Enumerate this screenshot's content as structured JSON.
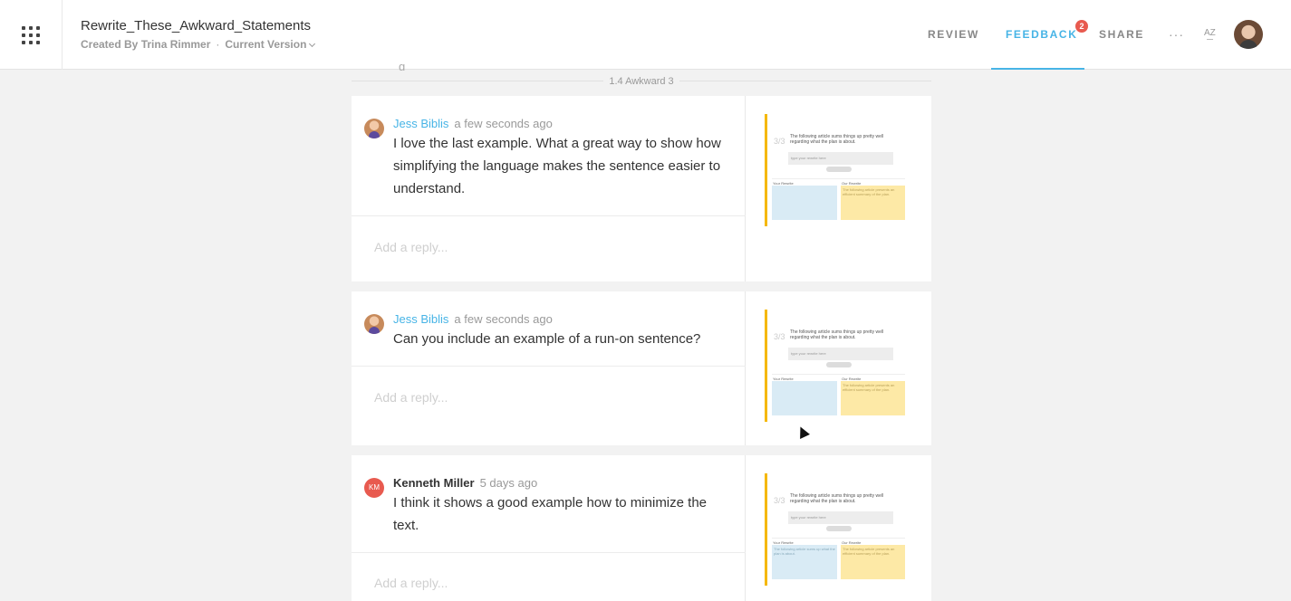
{
  "header": {
    "title": "Rewrite_These_Awkward_Statements",
    "created_by": "Created By Trina Rimmer",
    "separator": "·",
    "version": "Current Version",
    "nav": {
      "review": "REVIEW",
      "feedback": "FEEDBACK",
      "share": "SHARE"
    },
    "feedback_badge": "2",
    "more": "···",
    "sort": "AZ"
  },
  "section": {
    "label": "1.4 Awkward 3",
    "partial_text": "g"
  },
  "comments": [
    {
      "author": "Jess Biblis",
      "time": "a few seconds ago",
      "text": "I love the last example. What a great way to show how simplifying the language makes the sentence easier to understand.",
      "reply_placeholder": "Add a reply..."
    },
    {
      "author": "Jess Biblis",
      "time": "a few seconds ago",
      "text": "Can you include an example of a run-on sentence?",
      "reply_placeholder": "Add a reply..."
    },
    {
      "author": "Kenneth Miller",
      "initials": "KM",
      "time": "5 days ago",
      "text": "I think it shows a good example how to minimize the text.",
      "reply_placeholder": "Add a reply..."
    }
  ],
  "thumbnail": {
    "number": "3/3",
    "title": "The following article sums things up pretty well regarding what the plan is about.",
    "input": "type your rewrite here",
    "your_rewrite": "Your Rewrite",
    "our_rewrite": "Our Rewrite",
    "our_text": "The following article presents an efficient summary of the plan.",
    "your_text_kenneth": "The following article sums up what the plan is about."
  },
  "colors": {
    "accent": "#47b4e6",
    "badge": "#e85a4f",
    "highlight_bar": "#f5b800"
  }
}
